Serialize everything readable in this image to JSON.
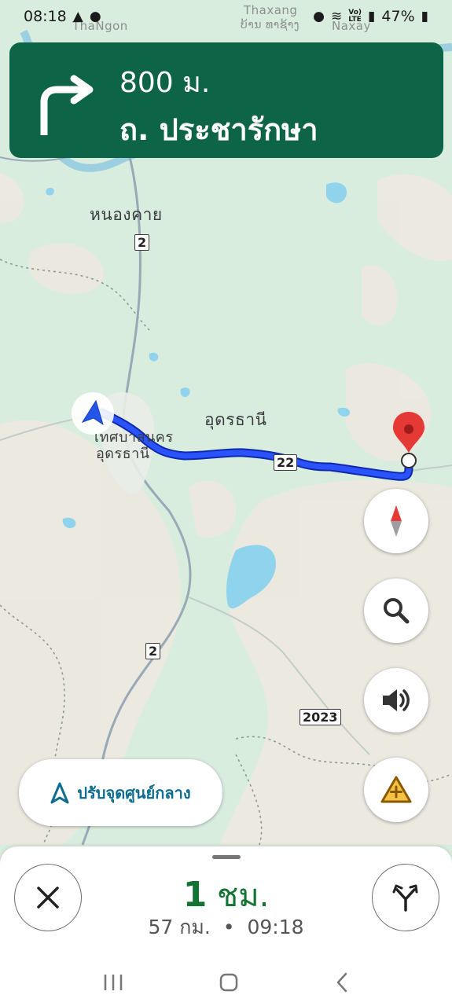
{
  "status_bar": {
    "time": "08:18",
    "signal_lte_top": "Vo)",
    "signal_lte_bottom": "LTE",
    "battery": "47%"
  },
  "navigation": {
    "distance": "800 ม.",
    "street": "ถ. ประชารักษา",
    "turn": "right"
  },
  "map": {
    "labels": {
      "top_left_region": "ThaNgon",
      "thaxang": "Thaxang",
      "lao_town": "ບ້ານ ທາຊ້າງ",
      "naxay": "Naxay",
      "nong_khai": "หนองคาย",
      "udon": "อุดรธานี",
      "udon_city_line1": "เทศบาลนคร",
      "udon_city_line2": "อุดรธานี"
    },
    "shields": {
      "route_2_top": "2",
      "route_22": "22",
      "route_2_bottom": "2",
      "route_2023": "2023"
    },
    "colors": {
      "route": "#1a3df0",
      "water": "#8fd3ec",
      "land": "#d9eddf",
      "pin": "#e53935"
    }
  },
  "controls": {
    "recenter_label": "ปรับจุดศูนย์กลาง",
    "compass_icon": "compass-icon",
    "search_icon": "search-icon",
    "sound_icon": "volume-icon",
    "report_icon": "add-report-icon"
  },
  "eta": {
    "duration_value": "1",
    "duration_unit": "ชม.",
    "distance": "57 กม.",
    "separator": "•",
    "arrival": "09:18"
  }
}
